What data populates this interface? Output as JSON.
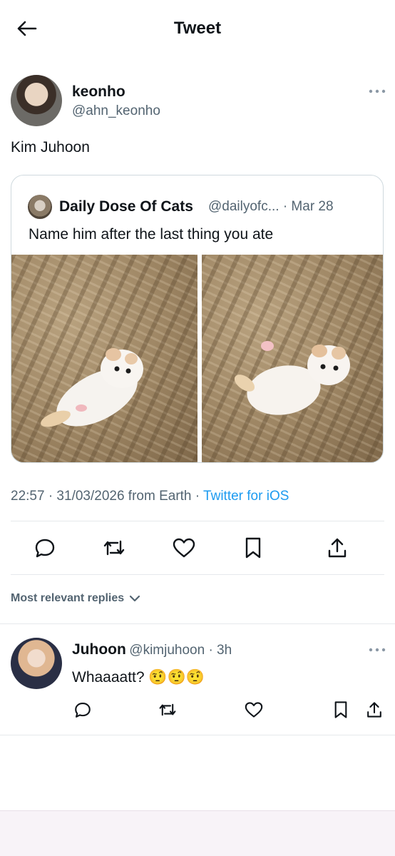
{
  "header": {
    "title": "Tweet"
  },
  "tweet": {
    "display_name": "keonho",
    "handle": "@ahn_keonho",
    "text": "Kim Juhoon",
    "timestamp": "22:57 · 31/03/2026 from Earth · ",
    "source": "Twitter for iOS"
  },
  "quoted": {
    "display_name": "Daily Dose Of Cats",
    "handle_date": "@dailyofc... · Mar 28",
    "text": "Name him after the last thing you ate"
  },
  "replies_filter": {
    "label": "Most relevant replies"
  },
  "reply": {
    "display_name": "Juhoon",
    "handle_time": "@kimjuhoon · 3h",
    "text": "Whaaaatt?",
    "emoji": "🤨🤨🤨"
  },
  "colors": {
    "link": "#1d9bf0",
    "muted": "#536471",
    "divider": "#e6e9ec",
    "bottom_bar": "#f8f3f8"
  },
  "icons": [
    "back-arrow-icon",
    "more-icon",
    "reply-icon",
    "retweet-icon",
    "like-icon",
    "bookmark-icon",
    "share-icon",
    "chevron-down-icon"
  ]
}
